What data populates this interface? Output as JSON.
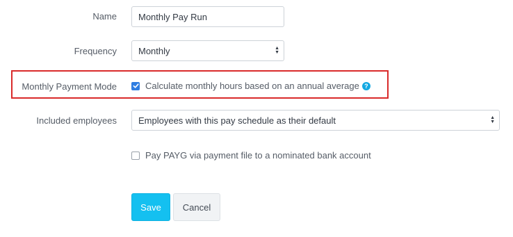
{
  "form": {
    "name": {
      "label": "Name",
      "value": "Monthly Pay Run"
    },
    "frequency": {
      "label": "Frequency",
      "value": "Monthly"
    },
    "monthly_payment_mode": {
      "label": "Monthly Payment Mode",
      "checkbox_label": "Calculate monthly hours based on an annual average",
      "checked": true,
      "help_icon": "?"
    },
    "included_employees": {
      "label": "Included employees",
      "value": "Employees with this pay schedule as their default"
    },
    "payg": {
      "checkbox_label": "Pay PAYG via payment file to a nominated bank account",
      "checked": false
    }
  },
  "buttons": {
    "save": "Save",
    "cancel": "Cancel"
  },
  "colors": {
    "highlight_border": "#d92a2a",
    "save_button": "#14c0f0",
    "checkbox_checked": "#2f7de1",
    "help_icon": "#14a9e2"
  }
}
